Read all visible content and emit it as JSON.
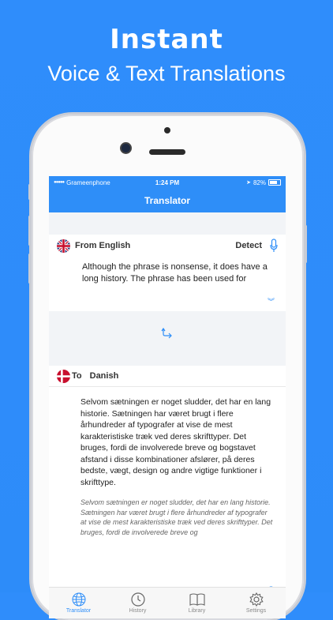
{
  "promo": {
    "headline": "Instant",
    "subheadline": "Voice & Text Translations"
  },
  "status_bar": {
    "carrier": "Grameenphone",
    "time": "1:24 PM",
    "battery": "82%"
  },
  "nav": {
    "title": "Translator"
  },
  "source": {
    "label": "From English",
    "action": "Detect",
    "text": "Although the phrase is nonsense, it does have a long history. The phrase has been used for"
  },
  "target": {
    "prefix": "To",
    "language": "Danish",
    "translation": "Selvom sætningen er noget sludder, det har en lang historie. Sætningen har været brugt i flere århundreder af typografer at vise de mest karakteristiske træk ved deres skrifttyper. Det bruges, fordi de involverede breve og bogstavet afstand i disse kombinationer afslører, på deres bedste, vægt, design og andre vigtige funktioner i skrifttype.",
    "alt_translation": "Selvom sætningen er noget sludder, det har en lang historie. Sætningen har været brugt i flere århundreder af typografer at vise de mest karakteristiske træk ved deres skrifttyper. Det bruges, fordi de involverede breve og"
  },
  "tabs": [
    {
      "label": "Translator",
      "icon": "globe-icon",
      "active": true
    },
    {
      "label": "History",
      "icon": "clock-icon",
      "active": false
    },
    {
      "label": "Library",
      "icon": "book-icon",
      "active": false
    },
    {
      "label": "Settings",
      "icon": "gear-icon",
      "active": false
    }
  ],
  "colors": {
    "accent": "#2e8ef8",
    "background": "#2f8dfb"
  }
}
